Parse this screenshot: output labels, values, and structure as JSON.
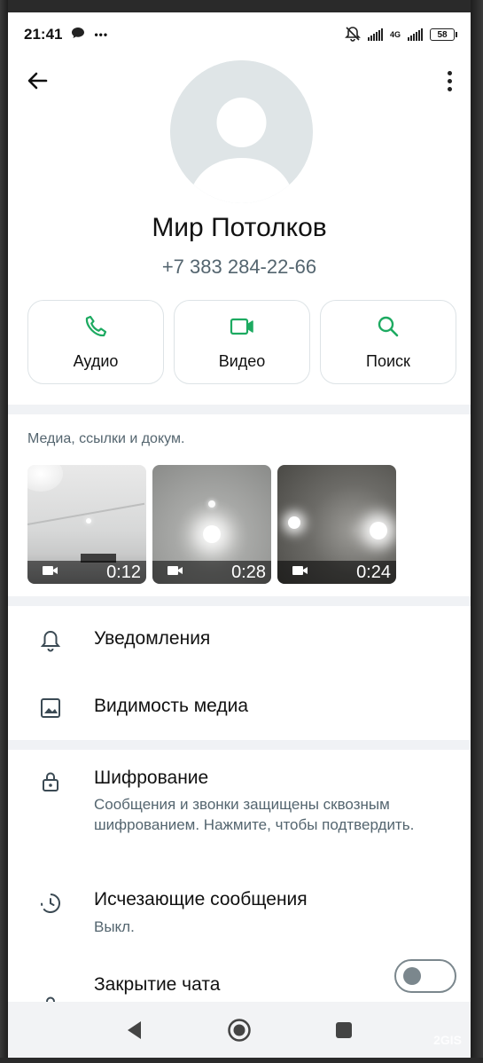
{
  "status_bar": {
    "time": "21:41",
    "dots": "•••",
    "battery": "58",
    "network": "4G"
  },
  "contact": {
    "name": "Мир Потолков",
    "phone": "+7 383 284-22-66"
  },
  "actions": [
    {
      "label": "Аудио",
      "icon": "phone-icon"
    },
    {
      "label": "Видео",
      "icon": "videocam-icon"
    },
    {
      "label": "Поиск",
      "icon": "search-icon"
    }
  ],
  "media": {
    "title": "Медиа, ссылки и докум.",
    "items": [
      {
        "duration": "0:12"
      },
      {
        "duration": "0:28"
      },
      {
        "duration": "0:24"
      }
    ]
  },
  "settings": {
    "notifications": "Уведомления",
    "media_visibility": "Видимость медиа",
    "encryption_title": "Шифрование",
    "encryption_sub": "Сообщения и звонки защищены сквозным шифрованием. Нажмите, чтобы подтвердить.",
    "disappearing_title": "Исчезающие сообщения",
    "disappearing_sub": "Выкл.",
    "chat_lock_title": "Закрытие чата"
  },
  "watermark": "2GIS",
  "colors": {
    "accent": "#1daa61",
    "secondary_text": "#54656f",
    "divider": "#f0f2f5"
  }
}
